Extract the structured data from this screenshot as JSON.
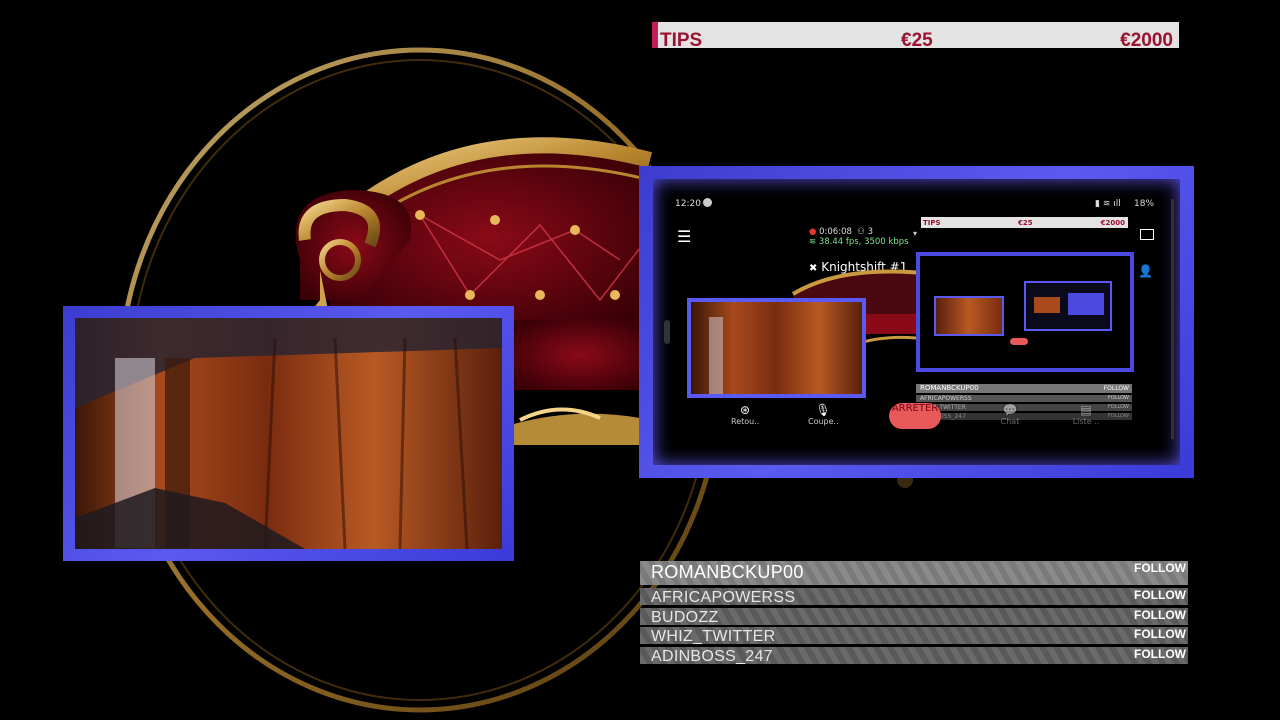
{
  "tips": {
    "label": "TIPS",
    "min_amount": "€25",
    "max_amount": "€2000"
  },
  "phone": {
    "time": "12:20",
    "battery": "18%",
    "stream_duration": "0:06:08",
    "viewer_count": "3",
    "stream_stats": "38.44 fps, 3500 kbps",
    "stream_title": "Knightshift #1",
    "controls": [
      {
        "label": "Retou..",
        "icon": "back-icon"
      },
      {
        "label": "Coupe..",
        "icon": "mic-icon"
      },
      {
        "label": "ARRETER",
        "icon": "stop-button"
      },
      {
        "label": "Chat",
        "icon": "chat-icon"
      },
      {
        "label": "Liste ..",
        "icon": "list-icon"
      }
    ],
    "mini_tips": {
      "label": "TIPS",
      "min_amount": "€25",
      "max_amount": "€2000"
    },
    "mini_follow": [
      {
        "name": "ROMANBCKUP00",
        "action": "FOLLOW"
      },
      {
        "name": "AFRICAPOWERSS",
        "action": "FOLLOW"
      },
      {
        "name": "WHIZ_TWITTER",
        "action": "FOLLOW"
      },
      {
        "name": "ADINBOSS_247",
        "action": "FOLLOW"
      }
    ]
  },
  "follow_list": [
    {
      "name": "ROMANBCKUP00",
      "action": "FOLLOW"
    },
    {
      "name": "AFRICAPOWERSS",
      "action": "FOLLOW"
    },
    {
      "name": "BUDOZZ",
      "action": "FOLLOW"
    },
    {
      "name": "WHIZ_TWITTER",
      "action": "FOLLOW"
    },
    {
      "name": "ADINBOSS_247",
      "action": "FOLLOW"
    }
  ],
  "colors": {
    "frame": "#4b4be6",
    "tips_text": "#9a1230",
    "tips_accent": "#c0205a",
    "stop_button": "#e85a5a"
  }
}
